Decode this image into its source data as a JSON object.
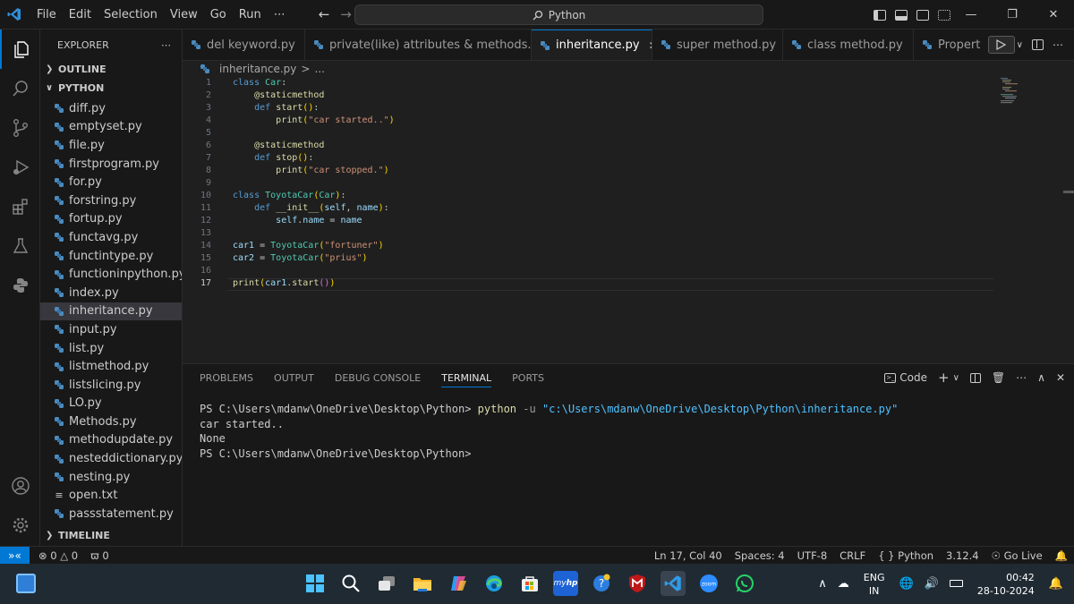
{
  "titlebar": {
    "menu": [
      "File",
      "Edit",
      "Selection",
      "View",
      "Go",
      "Run",
      "⋯"
    ],
    "search": "Python"
  },
  "sidebar": {
    "title": "EXPLORER",
    "more": "⋯",
    "outline": "OUTLINE",
    "folder": "PYTHON",
    "timeline": "TIMELINE",
    "files": [
      {
        "name": "diff.py",
        "type": "py"
      },
      {
        "name": "emptyset.py",
        "type": "py"
      },
      {
        "name": "file.py",
        "type": "py"
      },
      {
        "name": "firstprogram.py",
        "type": "py"
      },
      {
        "name": "for.py",
        "type": "py"
      },
      {
        "name": "forstring.py",
        "type": "py"
      },
      {
        "name": "fortup.py",
        "type": "py"
      },
      {
        "name": "functavg.py",
        "type": "py"
      },
      {
        "name": "functintype.py",
        "type": "py"
      },
      {
        "name": "functioninpython.py",
        "type": "py"
      },
      {
        "name": "index.py",
        "type": "py"
      },
      {
        "name": "inheritance.py",
        "type": "py",
        "selected": true
      },
      {
        "name": "input.py",
        "type": "py"
      },
      {
        "name": "list.py",
        "type": "py"
      },
      {
        "name": "listmethod.py",
        "type": "py"
      },
      {
        "name": "listslicing.py",
        "type": "py"
      },
      {
        "name": "LO.py",
        "type": "py"
      },
      {
        "name": "Methods.py",
        "type": "py"
      },
      {
        "name": "methodupdate.py",
        "type": "py"
      },
      {
        "name": "nesteddictionary.py",
        "type": "py"
      },
      {
        "name": "nesting.py",
        "type": "py"
      },
      {
        "name": "open.txt",
        "type": "txt"
      },
      {
        "name": "passstatement.py",
        "type": "py"
      }
    ]
  },
  "tabs": [
    {
      "label": "del keyword.py"
    },
    {
      "label": "private(like) attributes & methods.py"
    },
    {
      "label": "inheritance.py",
      "active": true
    },
    {
      "label": "super method.py"
    },
    {
      "label": "class method.py"
    },
    {
      "label": "Property.p"
    }
  ],
  "breadcrumb": {
    "file": "inheritance.py",
    "sep": ">",
    "rest": "..."
  },
  "editor": {
    "lines": [
      {
        "n": "1",
        "html": "<span class=\"kw\">class</span> <span class=\"cls\">Car</span>:"
      },
      {
        "n": "2",
        "html": "    <span class=\"dec\">@staticmethod</span>"
      },
      {
        "n": "3",
        "html": "    <span class=\"kw\">def</span> <span class=\"fn\">start</span><span class=\"p1\">()</span>:"
      },
      {
        "n": "4",
        "html": "        <span class=\"fn\">print</span><span class=\"p1\">(</span><span class=\"str\">\"car started..\"</span><span class=\"p1\">)</span>"
      },
      {
        "n": "5",
        "html": ""
      },
      {
        "n": "6",
        "html": "    <span class=\"dec\">@staticmethod</span>"
      },
      {
        "n": "7",
        "html": "    <span class=\"kw\">def</span> <span class=\"fn\">stop</span><span class=\"p1\">()</span>:"
      },
      {
        "n": "8",
        "html": "        <span class=\"fn\">print</span><span class=\"p1\">(</span><span class=\"str\">\"car stopped.\"</span><span class=\"p1\">)</span>"
      },
      {
        "n": "9",
        "html": ""
      },
      {
        "n": "10",
        "html": "<span class=\"kw\">class</span> <span class=\"cls\">ToyotaCar</span><span class=\"p1\">(</span><span class=\"cls\">Car</span><span class=\"p1\">)</span>:"
      },
      {
        "n": "11",
        "html": "    <span class=\"kw\">def</span> <span class=\"fn\">__init__</span><span class=\"p1\">(</span><span class=\"var\">self</span>, <span class=\"var\">name</span><span class=\"p1\">)</span>:"
      },
      {
        "n": "12",
        "html": "        <span class=\"var\">self</span>.<span class=\"var\">name</span> = <span class=\"var\">name</span>"
      },
      {
        "n": "13",
        "html": ""
      },
      {
        "n": "14",
        "html": "<span class=\"var\">car1</span> = <span class=\"cls\">ToyotaCar</span><span class=\"p1\">(</span><span class=\"str\">\"fortuner\"</span><span class=\"p1\">)</span>"
      },
      {
        "n": "15",
        "html": "<span class=\"var\">car2</span> = <span class=\"cls\">ToyotaCar</span><span class=\"p1\">(</span><span class=\"str\">\"prius\"</span><span class=\"p1\">)</span>"
      },
      {
        "n": "16",
        "html": ""
      },
      {
        "n": "17",
        "html": "<span class=\"fn\">print</span><span class=\"p1\">(</span><span class=\"var\">car1</span>.<span class=\"fn\">start</span><span class=\"p2\">()</span><span class=\"p1\">)</span>",
        "current": true
      }
    ]
  },
  "panel": {
    "tabs": [
      "PROBLEMS",
      "OUTPUT",
      "DEBUG CONSOLE",
      "TERMINAL",
      "PORTS"
    ],
    "active_tab": "TERMINAL",
    "shell_label": "Code",
    "terminal": {
      "prompt": "PS C:\\Users\\mdanw\\OneDrive\\Desktop\\Python>",
      "cmd": "python",
      "flag": "-u",
      "arg": "\"c:\\Users\\mdanw\\OneDrive\\Desktop\\Python\\inheritance.py\"",
      "out1": "car started..",
      "out2": "None",
      "prompt2": "PS C:\\Users\\mdanw\\OneDrive\\Desktop\\Python>"
    }
  },
  "status": {
    "errors": "0",
    "warnings": "0",
    "ports": "0",
    "position": "Ln 17, Col 40",
    "spaces": "Spaces: 4",
    "encoding": "UTF-8",
    "eol": "CRLF",
    "lang": "Python",
    "version": "3.12.4",
    "golive": "Go Live"
  },
  "taskbar": {
    "lang1": "ENG",
    "lang2": "IN",
    "time": "00:42",
    "date": "28-10-2024",
    "apps": [
      "windows-start-icon",
      "search-icon",
      "task-view-icon",
      "file-explorer-icon",
      "copilot-icon",
      "edge-icon",
      "store-icon",
      "hp-icon",
      "help-icon",
      "mcafee-icon",
      "vscode-icon",
      "zoom-icon",
      "whatsapp-icon"
    ]
  },
  "colors": {
    "accent": "#0078d4",
    "statusbar_remote": "#0078d4",
    "taskbar": "#202a33"
  }
}
